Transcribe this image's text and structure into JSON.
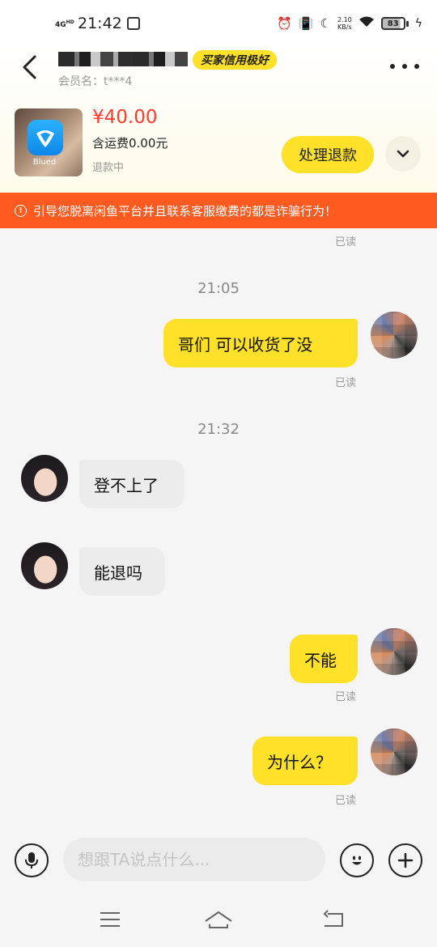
{
  "status_bar": {
    "network": "4G",
    "network_sub": "HD",
    "time": "21:42",
    "speed_value": "2.10",
    "speed_unit": "KB/s",
    "battery": "83"
  },
  "header": {
    "credit_badge": "买家信用极好",
    "member_label": "会员名：t***4",
    "product": {
      "app_label": "Blued",
      "price": "¥40.00",
      "shipping": "含运费0.00元",
      "status": "退款中"
    },
    "refund_button": "处理退款"
  },
  "warning": {
    "icon": "!",
    "text": "引导您脱离闲鱼平台并且联系客服缴费的都是诈骗行为！"
  },
  "chat": {
    "read_label": "已读",
    "timestamps": [
      "21:05",
      "21:32"
    ],
    "messages": [
      {
        "from": "me",
        "text": "哥们  可以收货了没",
        "read": "已读"
      },
      {
        "from": "other",
        "text": "登不上了"
      },
      {
        "from": "other",
        "text": "能退吗"
      },
      {
        "from": "me",
        "text": "不能",
        "read": "已读"
      },
      {
        "from": "me",
        "text": "为什么？",
        "read": "已读"
      }
    ]
  },
  "input": {
    "placeholder": "想跟TA说点什么..."
  },
  "colors": {
    "accent_yellow": "#ffe12a",
    "warning_orange": "#ff5a1f",
    "price_red": "#ff3b30",
    "app_blue": "#1a9bf5"
  },
  "icons": {
    "back": "back-arrow-icon",
    "more": "more-dots-icon",
    "expand": "chevron-down-icon",
    "voice": "microphone-icon",
    "emoji": "emoji-icon",
    "add": "plus-icon",
    "nav_menu": "menu-icon",
    "nav_home": "home-icon",
    "nav_back": "return-icon"
  }
}
